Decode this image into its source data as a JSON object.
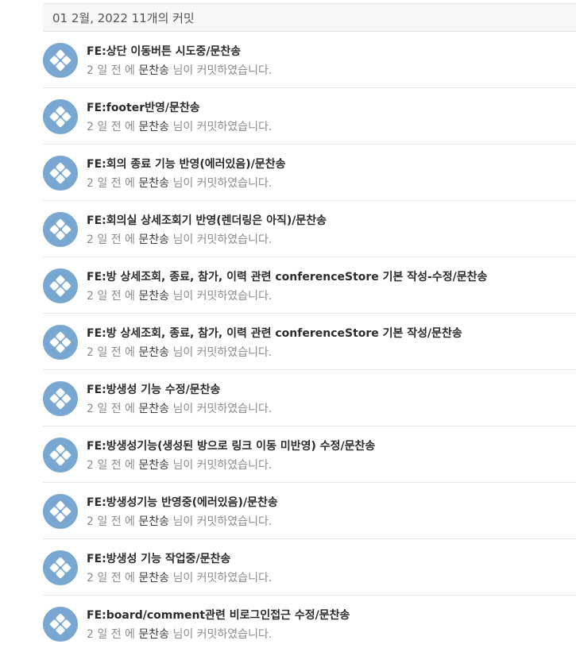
{
  "header": {
    "date_label": "01 2월, 2022 11개의 커밋"
  },
  "commits": [
    {
      "title": "FE:상단 이동버튼 시도중/문찬송",
      "time": "2 일 전 에",
      "author": "문찬송",
      "suffix": "님이 커밋하였습니다."
    },
    {
      "title": "FE:footer반영/문찬송",
      "time": "2 일 전 에",
      "author": "문찬송",
      "suffix": "님이 커밋하였습니다."
    },
    {
      "title": "FE:회의 종료 기능 반영(에러있음)/문찬송",
      "time": "2 일 전 에",
      "author": "문찬송",
      "suffix": "님이 커밋하였습니다."
    },
    {
      "title": "FE:회의실 상세조회기 반영(렌더링은 아직)/문찬송",
      "time": "2 일 전 에",
      "author": "문찬송",
      "suffix": "님이 커밋하였습니다."
    },
    {
      "title": "FE:방 상세조회, 종료, 참가, 이력 관련 conferenceStore 기본 작성-수정/문찬송",
      "time": "2 일 전 에",
      "author": "문찬송",
      "suffix": "님이 커밋하였습니다."
    },
    {
      "title": "FE:방 상세조회, 종료, 참가, 이력 관련 conferenceStore 기본 작성/문찬송",
      "time": "2 일 전 에",
      "author": "문찬송",
      "suffix": "님이 커밋하였습니다."
    },
    {
      "title": "FE:방생성 기능 수정/문찬송",
      "time": "2 일 전 에",
      "author": "문찬송",
      "suffix": "님이 커밋하였습니다."
    },
    {
      "title": "FE:방생성기능(생성된 방으로 링크 이동 미반영) 수정/문찬송",
      "time": "2 일 전 에",
      "author": "문찬송",
      "suffix": "님이 커밋하였습니다."
    },
    {
      "title": "FE:방생성기능 반영중(에러있음)/문찬송",
      "time": "2 일 전 에",
      "author": "문찬송",
      "suffix": "님이 커밋하였습니다."
    },
    {
      "title": "FE:방생성 기능 작업중/문찬송",
      "time": "2 일 전 에",
      "author": "문찬송",
      "suffix": "님이 커밋하였습니다."
    },
    {
      "title": "FE:board/comment관련 비로그인접근 수정/문찬송",
      "time": "2 일 전 에",
      "author": "문찬송",
      "suffix": "님이 커밋하였습니다."
    }
  ],
  "avatar_icon": "default-avatar-icon",
  "colors": {
    "avatar_bg": "#78a7d2",
    "title_text": "#2b2b2b",
    "meta_text": "#8c8c8c"
  }
}
